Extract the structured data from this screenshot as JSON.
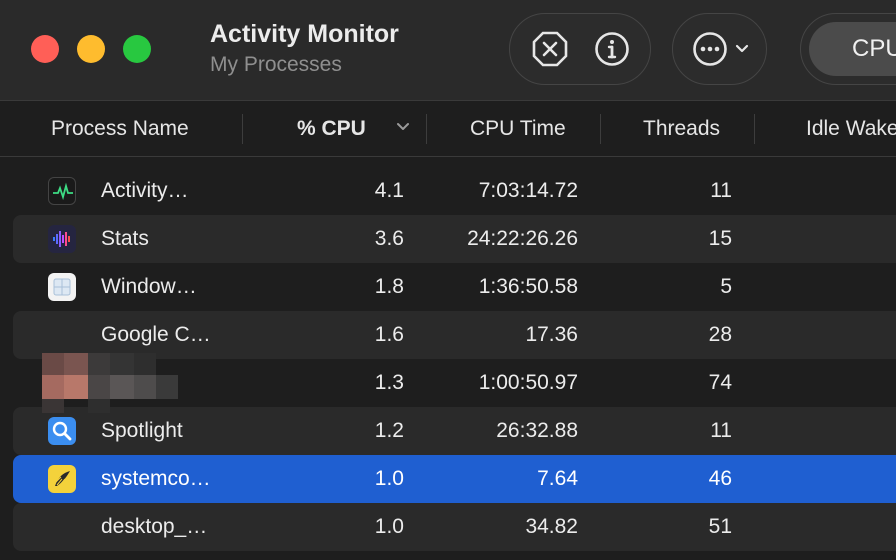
{
  "window": {
    "title": "Activity Monitor",
    "subtitle": "My Processes"
  },
  "toolbar": {
    "stop_icon": "stop-x-octagon-icon",
    "info_icon": "info-circle-icon",
    "more_icon": "ellipsis-circle-icon",
    "segment_selected": "CPU"
  },
  "columns": {
    "name": "Process Name",
    "cpu": "% CPU",
    "cpu_time": "CPU Time",
    "threads": "Threads",
    "idle_wake": "Idle Wake"
  },
  "colors": {
    "selection": "#1f5fd1",
    "close": "#ff5f57",
    "minimize": "#febc2e",
    "zoom": "#28c840"
  },
  "processes": [
    {
      "name": "Activity…",
      "cpu": "4.1",
      "cpu_time": "7:03:14.72",
      "threads": "11",
      "icon": "activity-monitor-icon"
    },
    {
      "name": "Stats",
      "cpu": "3.6",
      "cpu_time": "24:22:26.26",
      "threads": "15",
      "icon": "stats-icon"
    },
    {
      "name": "Window…",
      "cpu": "1.8",
      "cpu_time": "1:36:50.58",
      "threads": "5",
      "icon": "window-app-icon"
    },
    {
      "name": "Google C…",
      "cpu": "1.6",
      "cpu_time": "17.36",
      "threads": "28",
      "icon": ""
    },
    {
      "name": "",
      "cpu": "1.3",
      "cpu_time": "1:00:50.97",
      "threads": "74",
      "icon": "redacted-icon"
    },
    {
      "name": "Spotlight",
      "cpu": "1.2",
      "cpu_time": "26:32.88",
      "threads": "11",
      "icon": "spotlight-icon"
    },
    {
      "name": "systemco…",
      "cpu": "1.0",
      "cpu_time": "7.64",
      "threads": "46",
      "icon": "systemco-icon",
      "selected": true
    },
    {
      "name": "desktop_…",
      "cpu": "1.0",
      "cpu_time": "34.82",
      "threads": "51",
      "icon": ""
    }
  ]
}
